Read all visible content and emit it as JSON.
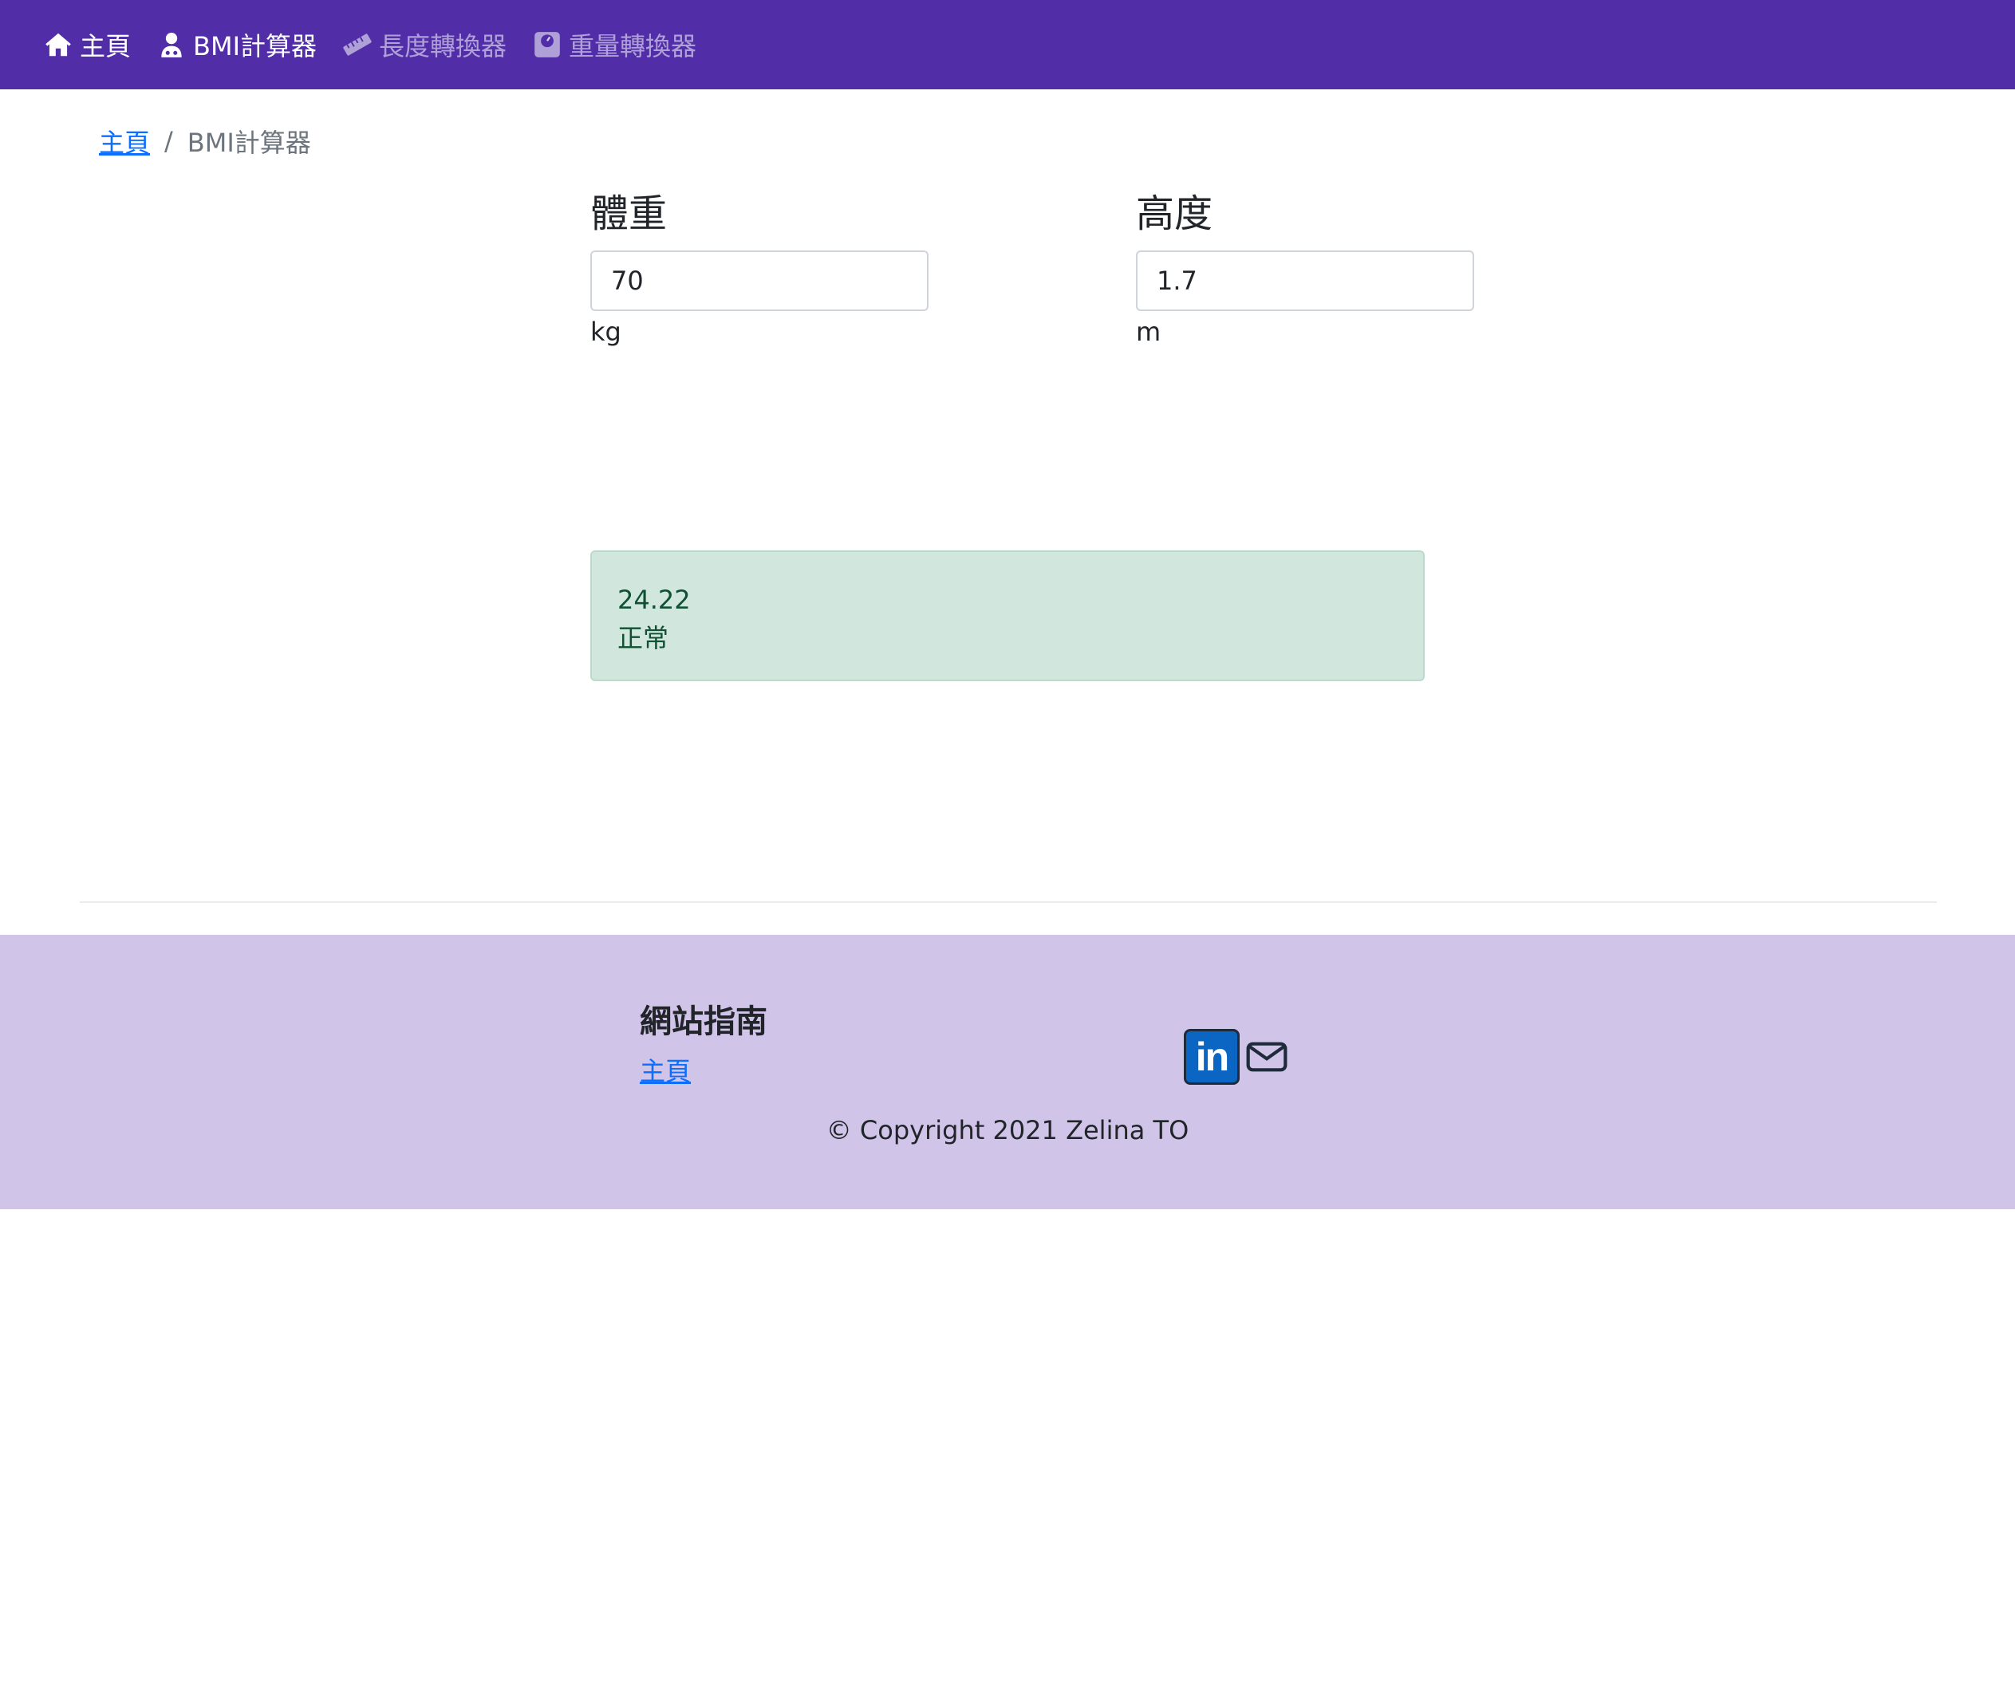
{
  "navbar": {
    "items": [
      {
        "label": "主頁",
        "icon": "home-icon",
        "active": true
      },
      {
        "label": "BMI計算器",
        "icon": "user-doctor-icon",
        "active": true
      },
      {
        "label": "長度轉換器",
        "icon": "ruler-icon",
        "active": false
      },
      {
        "label": "重量轉換器",
        "icon": "weight-scale-icon",
        "active": false
      }
    ],
    "background_color": "#512da8"
  },
  "breadcrumb": {
    "home_label": "主頁",
    "separator": "/",
    "current_label": "BMI計算器"
  },
  "form": {
    "weight": {
      "label": "體重",
      "value": "70",
      "unit": "kg"
    },
    "height": {
      "label": "高度",
      "value": "1.7",
      "unit": "m"
    }
  },
  "result": {
    "bmi": "24.22",
    "category": "正常",
    "background_color": "#d1e7dd",
    "text_color": "#0f5132"
  },
  "footer": {
    "title": "網站指南",
    "link_label": "主頁",
    "linkedin_text": "in",
    "copyright": "© Copyright 2021 Zelina TO",
    "background_color": "#d1c4e9"
  }
}
